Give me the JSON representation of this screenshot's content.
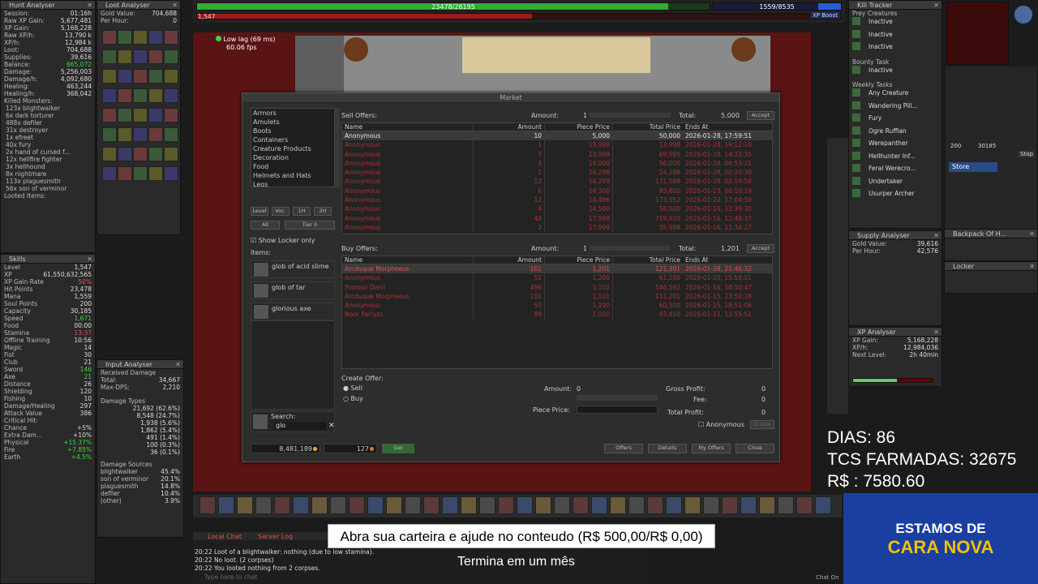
{
  "top": {
    "hp": "23478/26195",
    "mana": "1559/8535",
    "level_prefix": "1,547",
    "xp_boost": "XP Boost"
  },
  "hunt": {
    "title": "Hunt Analyser",
    "rows": [
      [
        "Session:",
        "01:16h"
      ],
      [
        "Raw XP Gain:",
        "5,677,481"
      ],
      [
        "XP Gain:",
        "5,168,228"
      ],
      [
        "Raw XP/h:",
        "13,790 k"
      ],
      [
        "XP/h:",
        "12,984 k"
      ],
      [
        "Loot:",
        "704,688"
      ],
      [
        "Supplies:",
        "39,616"
      ],
      [
        "Balance:",
        "665,072"
      ],
      [
        "Damage:",
        "5,256,003"
      ],
      [
        "Damage/h:",
        "4,092,680"
      ],
      [
        "Healing:",
        "463,244"
      ],
      [
        "Healing/h:",
        "368,042"
      ]
    ],
    "killed_title": "Killed Monsters:",
    "killed": [
      "123x blightwalker",
      "6x dark torturer",
      "488x defiler",
      "31x destroyer",
      "1x efreet",
      "40x fury",
      "2x hand of cursed f...",
      "12x hellfire fighter",
      "3x hellhound",
      "8x nightmare",
      "113x plaguesmith",
      "56x son of verminor"
    ],
    "looted": "Looted Items:"
  },
  "loot": {
    "title": "Loot Analyser",
    "gold_label": "Gold Value:",
    "gold": "704,688",
    "perhour_label": "Per Hour:",
    "perhour": "0"
  },
  "skills": {
    "title": "Skills",
    "rows": [
      [
        "Level",
        "1,547"
      ],
      [
        "XP",
        "61,550,632,565"
      ],
      [
        "XP Gain Rate",
        "50%"
      ],
      [
        "Hit Points",
        "23,478"
      ],
      [
        "Mana",
        "1,559"
      ],
      [
        "Soul Points",
        "200"
      ],
      [
        "Capacity",
        "30,185"
      ],
      [
        "Speed",
        "1,671"
      ],
      [
        "Food",
        "00:00"
      ],
      [
        "Stamina",
        "13:37"
      ],
      [
        "Offline Training",
        "10:56"
      ],
      [
        "Magic",
        "14"
      ],
      [
        "Fist",
        "30"
      ],
      [
        "Club",
        "21"
      ],
      [
        "Sword",
        "146"
      ],
      [
        "Axe",
        "21"
      ],
      [
        "Distance",
        "26"
      ],
      [
        "Shielding",
        "120"
      ],
      [
        "Fishing",
        "10"
      ],
      [
        "Damage/Healing",
        "297"
      ],
      [
        "Attack Value",
        "386"
      ],
      [
        "Critical Hit:",
        ""
      ],
      [
        "Chance",
        "+5%"
      ],
      [
        "Extra Dam...",
        "+10%"
      ],
      [
        "Physical",
        "+15.37%"
      ],
      [
        "Fire",
        "+7.85%"
      ],
      [
        "Earth",
        "+4.5%"
      ]
    ],
    "xp_boost": "XP Boost"
  },
  "input": {
    "title": "Input Analyser",
    "received": "Received Damage",
    "total_label": "Total:",
    "total": "34,667",
    "maxdps_label": "Max-DPS:",
    "maxdps": "2,210",
    "types_title": "Damage Types",
    "types": [
      [
        "21,692 (62.6%)"
      ],
      [
        "8,548 (24.7%)"
      ],
      [
        "1,938 (5.6%)"
      ],
      [
        "1,862 (5.4%)"
      ],
      [
        "491 (1.4%)"
      ],
      [
        "100 (0.3%)"
      ],
      [
        "36 (0.1%)"
      ]
    ],
    "sources_title": "Damage Sources",
    "sources": [
      [
        "blightwalker",
        "45.4%"
      ],
      [
        "son of verminor",
        "20.1%"
      ],
      [
        "plaguesmith",
        "14.8%"
      ],
      [
        "defiler",
        "10.4%"
      ],
      [
        "(other)",
        "3.9%"
      ]
    ]
  },
  "status": {
    "lag": "Low lag (69 ms)",
    "fps": "60.06 fps"
  },
  "market": {
    "title": "Market",
    "categories": [
      "Armors",
      "Amulets",
      "Boots",
      "Containers",
      "Creature Products",
      "Decoration",
      "Food",
      "Helmets and Hats",
      "Legs"
    ],
    "filters": [
      "Level",
      "Voc.",
      "1H",
      "2H"
    ],
    "all": "All",
    "tier": "Tier 0",
    "show_locker": "Show Locker only",
    "items_label": "Items:",
    "items": [
      "glob of acid slime",
      "glob of tar",
      "glorious axe"
    ],
    "search_label": "Search:",
    "search_value": "glo",
    "balance": "8,481,189",
    "coins": "127",
    "get_btn": "Get",
    "sell_label": "Sell Offers:",
    "sell_amount_label": "Amount:",
    "sell_amount": "1",
    "sell_total_label": "Total:",
    "sell_total": "5,000",
    "accept": "Accept",
    "headers": [
      "Name",
      "Amount",
      "Piece Price",
      "Total Price",
      "Ends At"
    ],
    "sell_rows": [
      [
        "Anonymous",
        "10",
        "5,000",
        "50,000",
        "2026-01-28, 17:59:51"
      ],
      [
        "Anonymous",
        "1",
        "13,998",
        "13,998",
        "2026-01-28, 19:12:10"
      ],
      [
        "Anonymous",
        "5",
        "13,999",
        "69,995",
        "2026-01-28, 14:22:35"
      ],
      [
        "Anonymous",
        "4",
        "14,000",
        "56,000",
        "2026-01-28, 06:53:21"
      ],
      [
        "Anonymous",
        "1",
        "14,298",
        "14,298",
        "2026-01-28, 02:20:30"
      ],
      [
        "Anonymous",
        "12",
        "14,299",
        "171,588",
        "2026-01-28, 02:14:58"
      ],
      [
        "Anonymous",
        "6",
        "14,300",
        "85,800",
        "2026-01-23, 00:10:19"
      ],
      [
        "Anonymous",
        "12",
        "14,496",
        "173,952",
        "2026-01-22, 17:04:59"
      ],
      [
        "Anonymous",
        "4",
        "14,500",
        "58,000",
        "2026-01-16, 12:39:30"
      ],
      [
        "Anonymous",
        "40",
        "17,998",
        "719,920",
        "2026-01-16, 12:48:37"
      ],
      [
        "Anonymous",
        "2",
        "17,999",
        "35,998",
        "2026-01-16, 11:34:27"
      ]
    ],
    "buy_label": "Buy Offers:",
    "buy_amount_label": "Amount:",
    "buy_amount": "1",
    "buy_total_label": "Total:",
    "buy_total": "1,201",
    "buy_rows": [
      [
        "Arcduque Morpheeus",
        "101",
        "1,201",
        "121,301",
        "2026-01-28, 21:46:32"
      ],
      [
        "Anonymous",
        "51",
        "1,200",
        "61,200",
        "2026-01-20, 15:58:01"
      ],
      [
        "Promon Dahil",
        "496",
        "1,102",
        "546,592",
        "2026-01-16, 18:50:47"
      ],
      [
        "Arcduque Morpheeus",
        "101",
        "1,101",
        "111,201",
        "2026-01-15, 23:50:18"
      ],
      [
        "Anonymous",
        "55",
        "1,100",
        "60,500",
        "2026-01-15, 18:51:06"
      ],
      [
        "Noor Parryzs",
        "89",
        "1,050",
        "93,450",
        "2026-01-11, 13:55:51"
      ]
    ],
    "create_label": "Create Offer:",
    "sell_opt": "Sell",
    "buy_opt": "Buy",
    "co_amount_label": "Amount:",
    "co_amount": "0",
    "piece_label": "Piece Price:",
    "gross_label": "Gross Profit:",
    "gross": "0",
    "fee_label": "Fee:",
    "fee": "0",
    "total_profit_label": "Total Profit:",
    "total_profit": "0",
    "anon_label": "Anonymous",
    "create_btn": "Create",
    "footer_btns": [
      "Offers",
      "Details",
      "My Offers",
      "Close"
    ]
  },
  "kill": {
    "title": "Kill Tracker",
    "prey": "Prey Creatures",
    "prey_items": [
      "Inactive",
      "Inactive",
      "Inactive"
    ],
    "bounty": "Bounty Task",
    "bounty_items": [
      "Inactive"
    ],
    "weekly": "Weekly Tasks",
    "weekly_items": [
      "Any Creature",
      "Wandering Pill...",
      "Fury",
      "Ogre Ruffian",
      "Werepanther",
      "Hellhunter Inf...",
      "Feral Werecro...",
      "Undertaker",
      "Usurper Archer"
    ]
  },
  "supply": {
    "title": "Supply Analyser",
    "gold_label": "Gold Value:",
    "gold": "39,616",
    "perhour_label": "Per Hour:",
    "perhour": "42,576"
  },
  "xpan": {
    "title": "XP Analyser",
    "gain_label": "XP Gain:",
    "gain": "5,168,228",
    "xph_label": "XP/h:",
    "xph": "12,984,036",
    "next_label": "Next Level:",
    "next": "2h 40min"
  },
  "backpack": {
    "title": "Backpack Of H...",
    "store": "Store",
    "locker": "Locker",
    "stat1": "200",
    "stat2": "30185",
    "stop": "Stop"
  },
  "chat": {
    "tabs": [
      "Local Chat",
      "Server Log"
    ],
    "lines": [
      "20:22 Loot of a blightwalker: nothing (due to low stamina).",
      "20:22 No loot. (2 corpses)",
      "20:22 You looted nothing from 2 corpses."
    ],
    "input_placeholder": "Type here to chat",
    "chat_on": "Chat On"
  },
  "stream": {
    "dias": "DIAS: 86",
    "tcs": "TCS FARMADAS: 32675",
    "rs": "R$ : 7580.60",
    "banner": "Abra sua carteira e ajude no conteudo (R$ 500,00/R$ 0,00)",
    "sub": "Termina em um mês",
    "promo1": "ESTAMOS DE",
    "promo2": "CARA NOVA"
  },
  "colors": {
    "hp": "#2fae2f",
    "mana": "#2a5bd7",
    "accent": "#e8b020",
    "warn": "#e05050",
    "promo_bg": "#1b3fa0",
    "promo_text2": "#f2c300"
  }
}
